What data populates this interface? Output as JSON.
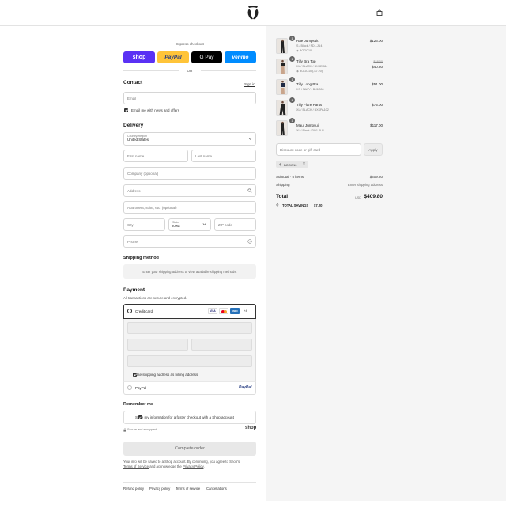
{
  "header": {
    "logo_icon": "brand-logo-icon",
    "cart_icon": "shopping-bag-icon"
  },
  "express": {
    "title": "Express checkout",
    "buttons": [
      {
        "label": "shop",
        "color": "#5a31f4"
      },
      {
        "label": "PayPal",
        "color": "#ffc439"
      },
      {
        "label": "G Pay",
        "color": "#000000"
      },
      {
        "label": "venmo",
        "color": "#008cff"
      }
    ],
    "or_label": "OR"
  },
  "contact": {
    "title": "Contact",
    "sign_in": "Sign in",
    "email_placeholder": "Email",
    "news_label": "Email me with news and offers"
  },
  "delivery": {
    "title": "Delivery",
    "country_label": "Country/Region",
    "country_value": "United States",
    "first_name": "First name",
    "last_name": "Last name",
    "company": "Company (optional)",
    "address": "Address",
    "apartment": "Apartment, suite, etc. (optional)",
    "city": "City",
    "state_label": "State",
    "state_value": "Iowa",
    "zip": "ZIP code",
    "phone": "Phone"
  },
  "shipping": {
    "title": "Shipping method",
    "notice": "Enter your shipping address to view available shipping methods."
  },
  "payment": {
    "title": "Payment",
    "subtitle": "All transactions are secure and encrypted.",
    "credit_card_label": "Credit card",
    "card_brands": [
      "VISA",
      "MC",
      "AMEX"
    ],
    "more_brands": "+4",
    "billing_label": "Use shipping address as billing address",
    "paypal_label": "PayPal",
    "paypal_logo": "PayPal"
  },
  "remember": {
    "title": "Remember me",
    "save_label": "Save my information for a faster checkout with a Shop account",
    "secure_label": "Secure and encrypted",
    "shop_logo": "shop"
  },
  "complete": {
    "button_label": "Complete order",
    "legal_1": "Your info will be saved to a Shop account. By continuing, you agree to Shop's",
    "terms": "Terms of Service",
    "legal_2": " and acknowledge the ",
    "privacy": "Privacy Policy",
    "legal_3": "."
  },
  "footer_links": [
    "Refund policy",
    "Privacy policy",
    "Terms of service",
    "Cancellations"
  ],
  "cart": {
    "items": [
      {
        "qty": "1",
        "name": "Rae Jumpsuit",
        "variant": "S / Black / FD1-JU4",
        "discount": "BOGO10",
        "price": "$126.00",
        "old_price": ""
      },
      {
        "qty": "1",
        "name": "Tilly Bra Top",
        "variant": "XL / BLACK / BXSER84",
        "discount": "BOGO10 (-$7.20)",
        "price": "$40.80",
        "old_price": "$48.00"
      },
      {
        "qty": "1",
        "name": "Tilly Long Bra",
        "variant": "XS / NAVY / BX6R80",
        "discount": "",
        "price": "$51.00",
        "old_price": ""
      },
      {
        "qty": "1",
        "name": "Tilly Flare Pants",
        "variant": "XL / BLACK / BXSPA102",
        "discount": "",
        "price": "$75.00",
        "old_price": ""
      },
      {
        "qty": "1",
        "name": "Maui Jumpsuit",
        "variant": "XL / Black / DD1-JU3",
        "discount": "",
        "price": "$117.00",
        "old_price": ""
      }
    ],
    "discount_placeholder": "Discount code or gift card",
    "apply_label": "Apply",
    "applied_code": "BOGO10",
    "subtotal_label": "Subtotal · 5 items",
    "subtotal_value": "$409.80",
    "shipping_label": "Shipping",
    "shipping_value": "Enter shipping address",
    "total_label": "Total",
    "currency": "USD",
    "total_value": "$409.80",
    "savings_label": "TOTAL SAVINGS",
    "savings_value": "$7.20"
  }
}
